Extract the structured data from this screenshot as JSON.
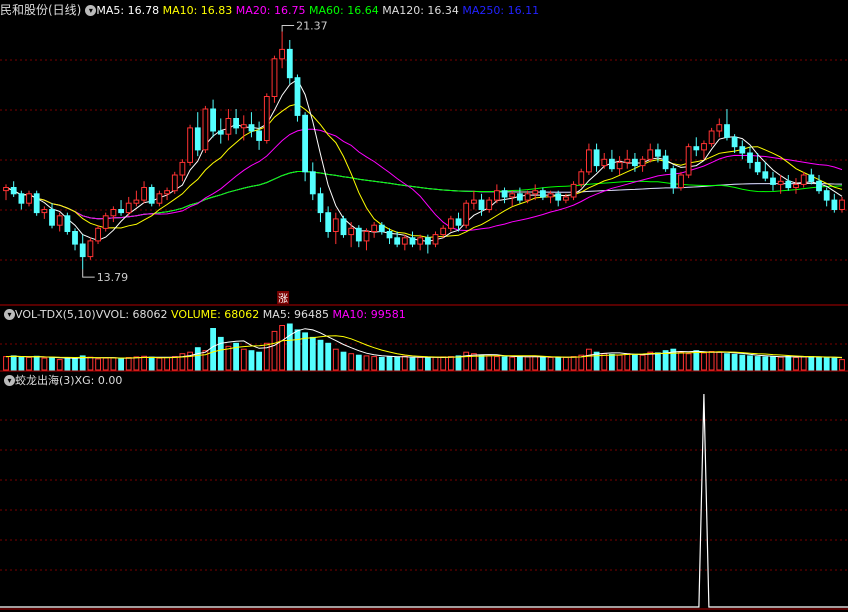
{
  "main_header": {
    "title": "民和股份(日线)",
    "ma": [
      {
        "label": "MA5: 16.78",
        "color": "#ffffff"
      },
      {
        "label": "MA10: 16.83",
        "color": "#ffff00"
      },
      {
        "label": "MA20: 16.75",
        "color": "#ff00ff"
      },
      {
        "label": "MA60: 16.64",
        "color": "#00ff00"
      },
      {
        "label": "MA120: 16.34",
        "color": "#dddddd"
      },
      {
        "label": "MA250: 16.11",
        "color": "#2222ff"
      }
    ]
  },
  "vol_header": {
    "title": "VOL-TDX(5,10)",
    "items": [
      {
        "label": "VVOL: 68062",
        "color": "#dddddd"
      },
      {
        "label": "VOLUME: 68062",
        "color": "#ffff00"
      },
      {
        "label": "MA5: 96485",
        "color": "#dddddd"
      },
      {
        "label": "MA10: 99581",
        "color": "#ff00ff"
      }
    ]
  },
  "ind_header": {
    "title": "蛟龙出海(3)",
    "items": [
      {
        "label": "XG: 0.00",
        "color": "#dddddd"
      }
    ]
  },
  "annotations": {
    "high_label": "21.37",
    "low_label": "13.79",
    "limit_up_mark": "涨"
  },
  "colors": {
    "up": "#ff3333",
    "down": "#54ffff",
    "grid": "#7a0000",
    "border": "#b00000"
  },
  "chart_data": [
    {
      "type": "candlestick",
      "title": "民和股份(日线)",
      "ylim": [
        13.2,
        21.8
      ],
      "high": 21.37,
      "low": 13.79,
      "candles": [
        [
          16.3,
          16.5,
          16.0,
          16.4
        ],
        [
          16.4,
          16.6,
          16.1,
          16.2
        ],
        [
          16.2,
          16.3,
          15.7,
          15.9
        ],
        [
          15.9,
          16.3,
          15.8,
          16.2
        ],
        [
          16.2,
          16.3,
          15.5,
          15.6
        ],
        [
          15.6,
          15.8,
          15.4,
          15.7
        ],
        [
          15.7,
          15.9,
          15.1,
          15.2
        ],
        [
          15.2,
          15.6,
          15.0,
          15.5
        ],
        [
          15.5,
          15.6,
          14.9,
          15.0
        ],
        [
          15.0,
          15.1,
          14.4,
          14.6
        ],
        [
          14.6,
          14.9,
          13.8,
          14.2
        ],
        [
          14.2,
          14.8,
          14.1,
          14.7
        ],
        [
          14.7,
          15.2,
          14.6,
          15.1
        ],
        [
          15.1,
          15.6,
          15.0,
          15.5
        ],
        [
          15.5,
          15.8,
          15.3,
          15.7
        ],
        [
          15.7,
          16.0,
          15.5,
          15.6
        ],
        [
          15.6,
          16.1,
          15.5,
          15.9
        ],
        [
          15.9,
          16.3,
          15.8,
          16.0
        ],
        [
          16.0,
          16.6,
          15.9,
          16.4
        ],
        [
          16.4,
          16.5,
          15.8,
          15.9
        ],
        [
          15.9,
          16.3,
          15.8,
          16.2
        ],
        [
          16.2,
          16.4,
          16.0,
          16.3
        ],
        [
          16.3,
          16.9,
          16.2,
          16.8
        ],
        [
          16.8,
          17.3,
          16.6,
          17.2
        ],
        [
          17.2,
          18.4,
          17.1,
          18.3
        ],
        [
          18.3,
          18.8,
          17.4,
          17.6
        ],
        [
          17.6,
          19.0,
          17.5,
          18.9
        ],
        [
          18.9,
          19.2,
          18.0,
          18.2
        ],
        [
          18.2,
          18.6,
          17.8,
          18.1
        ],
        [
          18.1,
          18.9,
          17.9,
          18.6
        ],
        [
          18.6,
          18.9,
          18.1,
          18.3
        ],
        [
          18.3,
          18.7,
          17.9,
          18.4
        ],
        [
          18.4,
          18.8,
          18.0,
          18.2
        ],
        [
          18.2,
          18.5,
          17.6,
          17.9
        ],
        [
          17.9,
          19.4,
          17.8,
          19.3
        ],
        [
          19.3,
          20.6,
          19.1,
          20.5
        ],
        [
          20.5,
          21.37,
          20.2,
          20.8
        ],
        [
          20.8,
          21.1,
          19.7,
          19.9
        ],
        [
          19.9,
          20.0,
          18.5,
          18.7
        ],
        [
          18.7,
          18.8,
          16.6,
          16.9
        ],
        [
          16.9,
          17.2,
          16.0,
          16.2
        ],
        [
          16.2,
          16.4,
          15.3,
          15.6
        ],
        [
          15.6,
          15.8,
          14.8,
          15.0
        ],
        [
          15.0,
          15.6,
          14.6,
          15.4
        ],
        [
          15.4,
          15.5,
          14.8,
          14.9
        ],
        [
          14.9,
          15.3,
          14.5,
          15.1
        ],
        [
          15.1,
          15.2,
          14.5,
          14.7
        ],
        [
          14.7,
          15.1,
          14.4,
          15.0
        ],
        [
          15.0,
          15.3,
          14.8,
          15.2
        ],
        [
          15.2,
          15.3,
          14.9,
          15.0
        ],
        [
          15.0,
          15.1,
          14.6,
          14.8
        ],
        [
          14.8,
          15.0,
          14.5,
          14.6
        ],
        [
          14.6,
          14.9,
          14.4,
          14.8
        ],
        [
          14.8,
          15.0,
          14.5,
          14.6
        ],
        [
          14.6,
          14.9,
          14.4,
          14.8
        ],
        [
          14.8,
          14.9,
          14.3,
          14.6
        ],
        [
          14.6,
          15.0,
          14.5,
          14.9
        ],
        [
          14.9,
          15.2,
          14.8,
          15.1
        ],
        [
          15.1,
          15.5,
          15.0,
          15.4
        ],
        [
          15.4,
          15.6,
          15.0,
          15.2
        ],
        [
          15.2,
          16.0,
          15.1,
          15.9
        ],
        [
          15.9,
          16.3,
          15.7,
          16.0
        ],
        [
          16.0,
          16.2,
          15.5,
          15.7
        ],
        [
          15.7,
          16.1,
          15.6,
          16.0
        ],
        [
          16.0,
          16.5,
          15.9,
          16.3
        ],
        [
          16.3,
          16.4,
          15.9,
          16.1
        ],
        [
          16.1,
          16.3,
          15.8,
          16.2
        ],
        [
          16.2,
          16.4,
          15.9,
          16.0
        ],
        [
          16.0,
          16.3,
          15.9,
          16.2
        ],
        [
          16.2,
          16.5,
          16.0,
          16.3
        ],
        [
          16.3,
          16.4,
          16.0,
          16.1
        ],
        [
          16.1,
          16.3,
          15.9,
          16.2
        ],
        [
          16.2,
          16.3,
          15.8,
          16.0
        ],
        [
          16.0,
          16.2,
          15.9,
          16.1
        ],
        [
          16.1,
          16.6,
          16.0,
          16.5
        ],
        [
          16.5,
          17.0,
          16.4,
          16.9
        ],
        [
          16.9,
          17.8,
          16.8,
          17.6
        ],
        [
          17.6,
          17.8,
          16.9,
          17.1
        ],
        [
          17.1,
          17.5,
          17.0,
          17.3
        ],
        [
          17.3,
          17.6,
          16.9,
          17.0
        ],
        [
          17.0,
          17.4,
          16.8,
          17.2
        ],
        [
          17.2,
          17.6,
          17.0,
          17.3
        ],
        [
          17.3,
          17.5,
          16.9,
          17.1
        ],
        [
          17.1,
          17.4,
          16.9,
          17.3
        ],
        [
          17.3,
          17.8,
          17.2,
          17.6
        ],
        [
          17.6,
          17.8,
          17.2,
          17.4
        ],
        [
          17.4,
          17.6,
          16.9,
          17.0
        ],
        [
          17.0,
          17.1,
          16.2,
          16.4
        ],
        [
          16.4,
          16.9,
          16.3,
          16.8
        ],
        [
          16.8,
          17.8,
          16.7,
          17.7
        ],
        [
          17.7,
          18.0,
          17.4,
          17.6
        ],
        [
          17.6,
          17.9,
          17.3,
          17.8
        ],
        [
          17.8,
          18.3,
          17.7,
          18.2
        ],
        [
          18.2,
          18.6,
          18.0,
          18.4
        ],
        [
          18.4,
          18.9,
          17.9,
          18.0
        ],
        [
          18.0,
          18.1,
          17.5,
          17.7
        ],
        [
          17.7,
          17.9,
          17.3,
          17.5
        ],
        [
          17.5,
          17.7,
          17.0,
          17.2
        ],
        [
          17.2,
          17.5,
          16.8,
          16.9
        ],
        [
          16.9,
          17.2,
          16.6,
          16.7
        ],
        [
          16.7,
          16.9,
          16.3,
          16.5
        ],
        [
          16.5,
          16.8,
          16.2,
          16.6
        ],
        [
          16.6,
          16.8,
          16.3,
          16.4
        ],
        [
          16.4,
          16.7,
          16.2,
          16.5
        ],
        [
          16.5,
          16.9,
          16.4,
          16.8
        ],
        [
          16.8,
          17.0,
          16.5,
          16.6
        ],
        [
          16.6,
          16.8,
          16.2,
          16.3
        ],
        [
          16.3,
          16.4,
          15.8,
          16.0
        ],
        [
          16.0,
          16.2,
          15.6,
          15.7
        ],
        [
          15.7,
          16.1,
          15.6,
          16.0
        ]
      ],
      "ma5_last": 16.78,
      "ma10_last": 16.83,
      "ma20_last": 16.75,
      "ma60_last": 16.64,
      "ma120_last": 16.34,
      "ma250_last": 16.11
    },
    {
      "type": "bar",
      "title": "VOL-TDX(5,10)",
      "last_volume": 68062,
      "ma5_last": 96485,
      "ma10_last": 99581,
      "volumes": [
        90,
        95,
        88,
        85,
        92,
        80,
        85,
        70,
        78,
        82,
        95,
        86,
        75,
        80,
        82,
        78,
        84,
        88,
        92,
        86,
        80,
        84,
        90,
        110,
        120,
        150,
        130,
        280,
        220,
        160,
        180,
        140,
        130,
        120,
        180,
        260,
        300,
        310,
        270,
        250,
        220,
        200,
        180,
        140,
        120,
        110,
        100,
        95,
        90,
        85,
        90,
        88,
        92,
        80,
        85,
        82,
        86,
        88,
        90,
        95,
        120,
        110,
        100,
        95,
        90,
        88,
        86,
        92,
        88,
        90,
        86,
        84,
        82,
        85,
        90,
        100,
        140,
        120,
        110,
        105,
        100,
        110,
        105,
        100,
        120,
        115,
        130,
        140,
        120,
        110,
        130,
        115,
        125,
        120,
        110,
        105,
        100,
        95,
        90,
        88,
        90,
        86,
        92,
        85,
        88,
        90,
        86,
        84,
        80,
        70
      ]
    },
    {
      "type": "line",
      "title": "蛟龙出海(3)",
      "series": [
        {
          "name": "XG",
          "last": 0.0,
          "spike_index": 91,
          "spike_value": 1
        }
      ]
    }
  ]
}
